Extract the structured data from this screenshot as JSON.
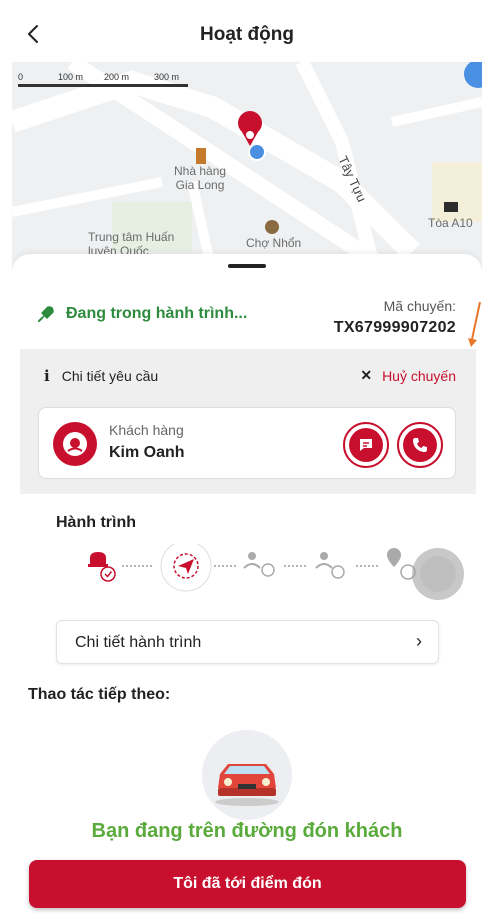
{
  "header": {
    "title": "Hoạt động",
    "back_icon": "chevron-left-icon"
  },
  "map": {
    "scale_labels": [
      "0",
      "100 m",
      "200 m",
      "300 m"
    ],
    "places": {
      "restaurant": "Nhà hàng\nGia Long",
      "training_center": "Trung tâm Huấn\nluyện Quốc",
      "market": "Chợ Nhổn",
      "building": "Tòa A10",
      "road": "Tây Tựu"
    }
  },
  "trip": {
    "status": "Đang trong hành trình...",
    "code_label": "Mã chuyến:",
    "code": "TX67999907202"
  },
  "request": {
    "title": "Chi tiết yêu cầu",
    "cancel_label": "Huỷ chuyến",
    "customer_label": "Khách hàng",
    "customer_name": "Kim Oanh"
  },
  "journey": {
    "title": "Hành trình",
    "link_label": "Chi tiết hành trình",
    "steps": [
      "driver-assigned-icon",
      "navigate-icon",
      "pickup-icon",
      "in-trip-icon",
      "destination-icon"
    ],
    "current_step": 2
  },
  "next": {
    "title": "Thao tác tiếp theo:",
    "message": "Bạn đang trên đường đón khách",
    "button_label": "Tôi đã tới điểm đón"
  },
  "colors": {
    "brand": "#c8102e",
    "status_green": "#2e8b3d",
    "message_green": "#5aab3c"
  }
}
